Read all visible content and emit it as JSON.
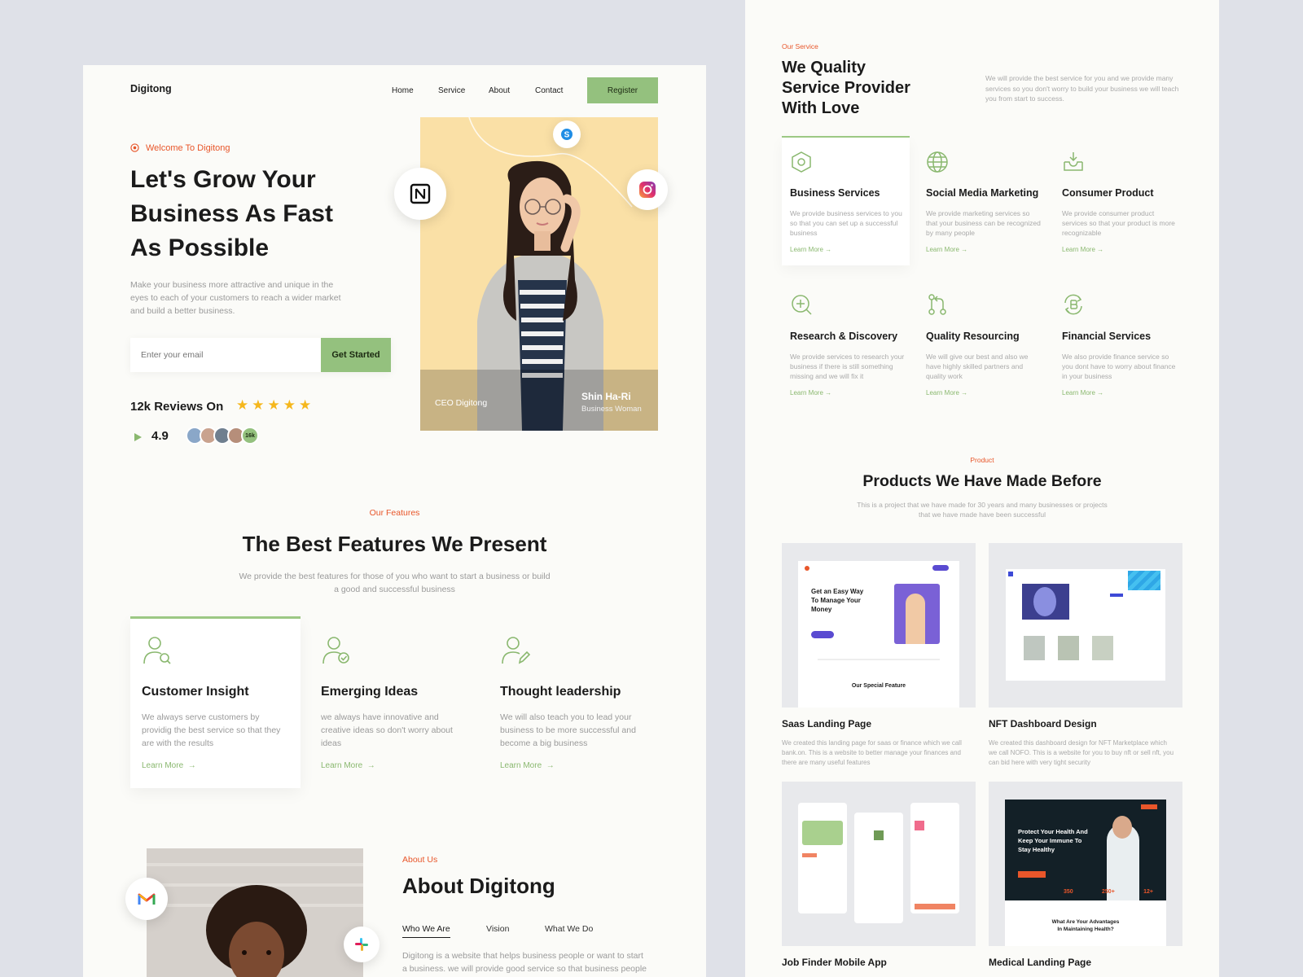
{
  "header": {
    "logo": "Digitong",
    "nav": [
      "Home",
      "Service",
      "About",
      "Contact"
    ],
    "register": "Register"
  },
  "hero": {
    "welcome": "Welcome To Digitong",
    "title_lines": [
      "Let's Grow Your",
      "Business As Fast",
      "As Possible"
    ],
    "desc_lines": [
      "Make your business more attractive and unique in the",
      "eyes to each of your customers to reach a wider market",
      "and build a better business."
    ],
    "email_placeholder": "Enter your email",
    "cta": "Get Started",
    "reviews": "12k Reviews On",
    "rating": "4.9",
    "stars": 5,
    "avatar_count": "16k",
    "photo_caption": "CEO Digitong",
    "person_name": "Shin Ha-Ri",
    "person_role": "Business Woman"
  },
  "features": {
    "eyebrow": "Our Features",
    "title": "The Best Features We Present",
    "desc_lines": [
      "We provide the best features for those of you who want to start a business or build",
      "a good and successful business"
    ],
    "items": [
      {
        "title": "Customer Insight",
        "desc_lines": [
          "We always serve customers by",
          "providig the best service so that they",
          "are with the results"
        ],
        "learn": "Learn More"
      },
      {
        "title": "Emerging Ideas",
        "desc_lines": [
          "we always have innovative and",
          "creative ideas so don't worry about",
          "ideas"
        ],
        "learn": "Learn More"
      },
      {
        "title": "Thought leadership",
        "desc_lines": [
          "We will also teach you to lead your",
          "business to be more successful and",
          "become a big business"
        ],
        "learn": "Learn More"
      }
    ]
  },
  "about": {
    "eyebrow": "About Us",
    "title": "About Digitong",
    "tabs": [
      "Who We Are",
      "Vision",
      "What We Do"
    ],
    "text_lines": [
      "Digitong is a website that helps business people or want to start",
      "a business. we will provide good service so that business people"
    ]
  },
  "service": {
    "eyebrow": "Our Service",
    "title_lines": [
      "We Quality",
      "Service Provider",
      "With Love"
    ],
    "desc_lines": [
      "We will provide the best service for you and we provide many",
      "services so you don't worry to build your business we will teach",
      "you from start to success."
    ],
    "items": [
      {
        "title": "Business Services",
        "icon": "hexagon-icon",
        "desc_lines": [
          "We provide business services to you",
          "so that you can set up a successful",
          "business"
        ],
        "learn": "Learn More"
      },
      {
        "title": "Social Media Marketing",
        "icon": "globe-icon",
        "desc_lines": [
          "We provide marketing services so",
          "that your business can be recognized",
          "by many people"
        ],
        "learn": "Learn More"
      },
      {
        "title": "Consumer Product",
        "icon": "inbox-icon",
        "desc_lines": [
          "We provide consumer product",
          "services so that your product is more",
          "recognizable"
        ],
        "learn": "Learn More"
      },
      {
        "title": "Research & Discovery",
        "icon": "search-plus-icon",
        "desc_lines": [
          "We provide services to research your",
          "business if there is still something",
          "missing and we will fix it"
        ],
        "learn": "Learn More"
      },
      {
        "title": "Quality Resourcing",
        "icon": "git-compare-icon",
        "desc_lines": [
          "We will give our best and also we",
          "have highly skilled partners and",
          "quality work"
        ],
        "learn": "Learn More"
      },
      {
        "title": "Financial Services",
        "icon": "bitcoin-refresh-icon",
        "desc_lines": [
          "We also provide finance service so",
          "you dont have to worry about finance",
          "in your business"
        ],
        "learn": "Learn More"
      }
    ]
  },
  "products": {
    "eyebrow": "Product",
    "title": "Products We Have Made Before",
    "desc_lines": [
      "This is a project that we have made for 30 years and many businesses or projects",
      "that we have made have been successful"
    ],
    "items": [
      {
        "title": "Saas Landing Page",
        "desc_lines": [
          "We created this landing page for saas or finance which we call",
          "bank.on. This is a website to better manage your finances and",
          "there are many useful features"
        ]
      },
      {
        "title": "NFT Dashboard Design",
        "desc_lines": [
          "We created this dashboard design for NFT Marketplace which",
          "we call NOFO. This is a website for you to buy nft or sell nft, you",
          "can bid here with very tight security"
        ]
      },
      {
        "title": "Job Finder Mobile App",
        "desc_lines": []
      },
      {
        "title": "Medical Landing Page",
        "desc_lines": []
      }
    ],
    "saas_thumb": {
      "headline_lines": [
        "Get an Easy Way",
        "To Manage Your",
        "Money"
      ],
      "section": "Our Special Feature"
    },
    "med_thumb": {
      "headline_lines": [
        "Protect Your Health And",
        "Keep Your Immune To",
        "Stay Healthy"
      ],
      "stats": [
        "350",
        "250+",
        "12+"
      ],
      "question_lines": [
        "What Are Your Advantages",
        "In Maintaining Health?"
      ]
    }
  },
  "colors": {
    "accent": "#94c17e",
    "eyebrow": "#e8562a",
    "background": "#dfe1e8",
    "panel": "#fbfbf8"
  }
}
